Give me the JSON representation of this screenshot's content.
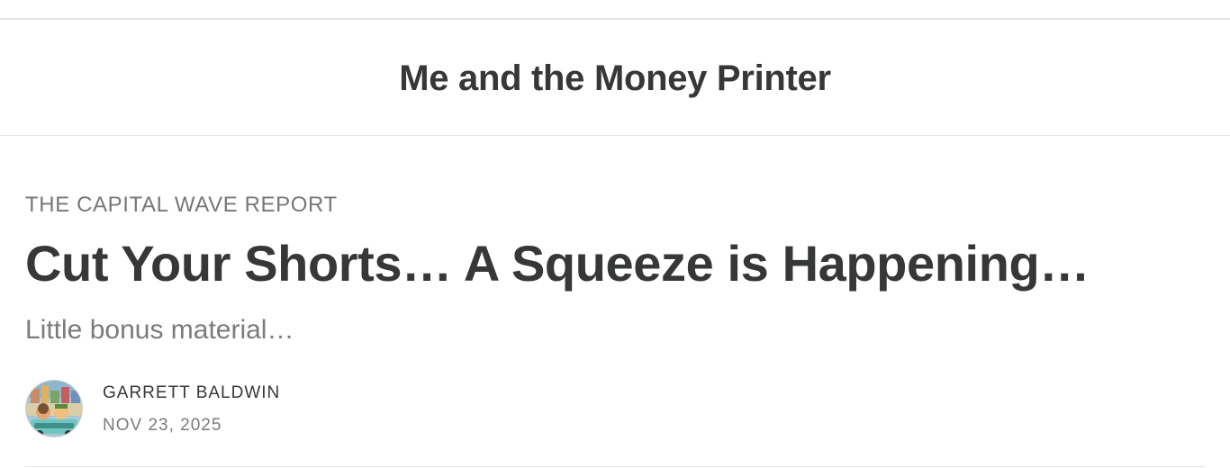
{
  "publication": {
    "title": "Me and the Money Printer"
  },
  "post": {
    "section": "THE CAPITAL WAVE REPORT",
    "title": "Cut Your Shorts… A Squeeze is Happening…",
    "subtitle": "Little bonus material…",
    "author": "GARRETT BALDWIN",
    "date": "NOV 23, 2025",
    "author_avatar_icon": "author-avatar-illustration"
  },
  "colors": {
    "text_primary": "#363737",
    "text_secondary": "#777777",
    "divider": "#e6e6e6"
  }
}
